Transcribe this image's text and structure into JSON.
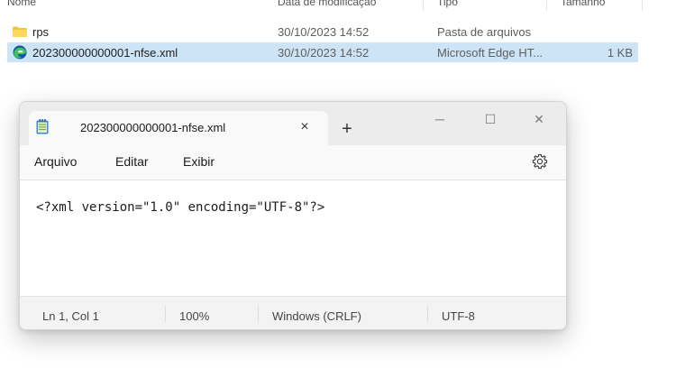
{
  "explorer": {
    "columns": {
      "name": "Nome",
      "date": "Data de modificação",
      "type": "Tipo",
      "size": "Tamanho"
    },
    "rows": [
      {
        "icon": "folder-icon",
        "name": "rps",
        "date": "30/10/2023 14:52",
        "type": "Pasta de arquivos",
        "size": ""
      },
      {
        "icon": "edge-icon",
        "name": "202300000000001-nfse.xml",
        "date": "30/10/2023 14:52",
        "type": "Microsoft Edge HT...",
        "size": "1 KB"
      }
    ],
    "selected_row": 1
  },
  "notepad": {
    "tab_title": "202300000000001-nfse.xml",
    "tab_close": "×",
    "new_tab": "+",
    "window_buttons": {
      "minimize": "─",
      "maximize": "☐",
      "close": "✕"
    },
    "menu": [
      "Arquivo",
      "Editar",
      "Exibir"
    ],
    "settings_icon": "gear-icon",
    "content": "<?xml version=\"1.0\" encoding=\"UTF-8\"?>",
    "status": {
      "position": "Ln 1, Col 1",
      "zoom": "100%",
      "line_ending": "Windows (CRLF)",
      "encoding": "UTF-8"
    }
  },
  "colors": {
    "selection": "#cde4f7",
    "folder": "#f4c542",
    "edge_blue": "#0c59a4",
    "edge_green": "#3ec25c"
  }
}
